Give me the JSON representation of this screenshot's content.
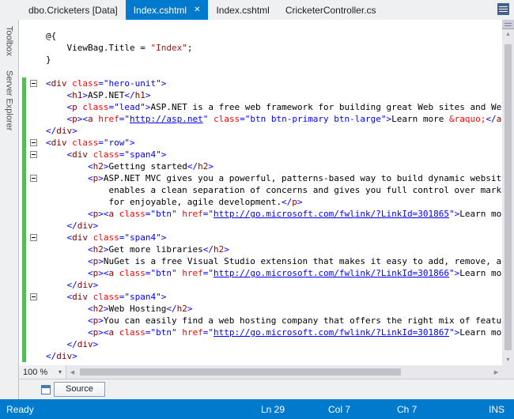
{
  "tabs": [
    {
      "label": "dbo.Cricketers [Data]",
      "active": false
    },
    {
      "label": "Index.cshtml",
      "active": true
    },
    {
      "label": "Index.cshtml",
      "active": false
    },
    {
      "label": "CricketerController.cs",
      "active": false
    }
  ],
  "tab_close_glyph": "✕",
  "side_tabs": [
    {
      "label": "Toolbox"
    },
    {
      "label": "Server Explorer"
    }
  ],
  "zoom": {
    "value": "100 %"
  },
  "view_tabs": {
    "source_label": "Source"
  },
  "status_bar": {
    "state": "Ready",
    "line": "Ln 29",
    "column": "Col 7",
    "character": "Ch 7",
    "mode": "INS"
  },
  "colors": {
    "accent": "#007ACC",
    "chrome_bg": "#EFF0F1",
    "editor_bg": "#FFFFFF",
    "change_bar": "#5BB75B",
    "tag_name": "#800000",
    "attr_name": "#FF0000",
    "attr_value": "#0000FF",
    "razor_string": "#A31515",
    "plain_text": "#000000"
  },
  "editor": {
    "lines": [
      {
        "g": false,
        "f": false,
        "s": [
          [
            "@{",
            "p"
          ]
        ]
      },
      {
        "g": false,
        "f": false,
        "s": [
          [
            "    ViewBag.Title = ",
            "p"
          ],
          [
            "\"Index\"",
            "s"
          ],
          [
            ";",
            "p"
          ]
        ]
      },
      {
        "g": false,
        "f": false,
        "s": [
          [
            "}",
            "p"
          ]
        ]
      },
      {
        "g": false,
        "f": false,
        "s": []
      },
      {
        "g": true,
        "f": true,
        "s": [
          [
            "<",
            "b"
          ],
          [
            "div",
            "t"
          ],
          [
            " ",
            "p"
          ],
          [
            "class",
            "a"
          ],
          [
            "=",
            "b"
          ],
          [
            "\"hero-unit\"",
            "b"
          ],
          [
            ">",
            "b"
          ]
        ]
      },
      {
        "g": true,
        "f": false,
        "s": [
          [
            "    ",
            "p"
          ],
          [
            "<",
            "b"
          ],
          [
            "h1",
            "t"
          ],
          [
            ">",
            "b"
          ],
          [
            "ASP.NET",
            "p"
          ],
          [
            "</",
            "b"
          ],
          [
            "h1",
            "t"
          ],
          [
            ">",
            "b"
          ]
        ]
      },
      {
        "g": true,
        "f": false,
        "s": [
          [
            "    ",
            "p"
          ],
          [
            "<",
            "b"
          ],
          [
            "p",
            "t"
          ],
          [
            " ",
            "p"
          ],
          [
            "class",
            "a"
          ],
          [
            "=",
            "b"
          ],
          [
            "\"lead\"",
            "b"
          ],
          [
            ">",
            "b"
          ],
          [
            "ASP.NET is a free web framework for building great Web sites and We",
            "p"
          ]
        ]
      },
      {
        "g": true,
        "f": false,
        "s": [
          [
            "    ",
            "p"
          ],
          [
            "<",
            "b"
          ],
          [
            "p",
            "t"
          ],
          [
            "><",
            "b"
          ],
          [
            "a",
            "t"
          ],
          [
            " ",
            "p"
          ],
          [
            "href",
            "a"
          ],
          [
            "=",
            "b"
          ],
          [
            "\"",
            "b"
          ],
          [
            "http://asp.net",
            "u"
          ],
          [
            "\"",
            "b"
          ],
          [
            " ",
            "p"
          ],
          [
            "class",
            "a"
          ],
          [
            "=",
            "b"
          ],
          [
            "\"btn btn-primary btn-large\"",
            "b"
          ],
          [
            ">",
            "b"
          ],
          [
            "Learn more ",
            "p"
          ],
          [
            "&raquo;",
            "a"
          ],
          [
            "</",
            "b"
          ],
          [
            "a",
            "t"
          ]
        ]
      },
      {
        "g": true,
        "f": false,
        "s": [
          [
            "</",
            "b"
          ],
          [
            "div",
            "t"
          ],
          [
            ">",
            "b"
          ]
        ]
      },
      {
        "g": true,
        "f": true,
        "s": [
          [
            "<",
            "b"
          ],
          [
            "div",
            "t"
          ],
          [
            " ",
            "p"
          ],
          [
            "class",
            "a"
          ],
          [
            "=",
            "b"
          ],
          [
            "\"row\"",
            "b"
          ],
          [
            ">",
            "b"
          ]
        ]
      },
      {
        "g": true,
        "f": true,
        "s": [
          [
            "    ",
            "p"
          ],
          [
            "<",
            "b"
          ],
          [
            "div",
            "t"
          ],
          [
            " ",
            "p"
          ],
          [
            "class",
            "a"
          ],
          [
            "=",
            "b"
          ],
          [
            "\"span4\"",
            "b"
          ],
          [
            ">",
            "b"
          ]
        ]
      },
      {
        "g": true,
        "f": false,
        "s": [
          [
            "        ",
            "p"
          ],
          [
            "<",
            "b"
          ],
          [
            "h2",
            "t"
          ],
          [
            ">",
            "b"
          ],
          [
            "Getting started",
            "p"
          ],
          [
            "</",
            "b"
          ],
          [
            "h2",
            "t"
          ],
          [
            ">",
            "b"
          ]
        ]
      },
      {
        "g": true,
        "f": true,
        "s": [
          [
            "        ",
            "p"
          ],
          [
            "<",
            "b"
          ],
          [
            "p",
            "t"
          ],
          [
            ">",
            "b"
          ],
          [
            "ASP.NET MVC gives you a powerful, patterns-based way to build dynamic websit",
            "p"
          ]
        ]
      },
      {
        "g": true,
        "f": false,
        "s": [
          [
            "            enables a clean separation of concerns and gives you full control over markup",
            "p"
          ]
        ]
      },
      {
        "g": true,
        "f": false,
        "s": [
          [
            "            for enjoyable, agile development.",
            "p"
          ],
          [
            "</",
            "b"
          ],
          [
            "p",
            "t"
          ],
          [
            ">",
            "b"
          ]
        ]
      },
      {
        "g": true,
        "f": false,
        "s": [
          [
            "        ",
            "p"
          ],
          [
            "<",
            "b"
          ],
          [
            "p",
            "t"
          ],
          [
            "><",
            "b"
          ],
          [
            "a",
            "t"
          ],
          [
            " ",
            "p"
          ],
          [
            "class",
            "a"
          ],
          [
            "=",
            "b"
          ],
          [
            "\"btn\"",
            "b"
          ],
          [
            " ",
            "p"
          ],
          [
            "href",
            "a"
          ],
          [
            "=",
            "b"
          ],
          [
            "\"",
            "b"
          ],
          [
            "http://go.microsoft.com/fwlink/?LinkId=301865",
            "u"
          ],
          [
            "\"",
            "b"
          ],
          [
            ">",
            "b"
          ],
          [
            "Learn mo",
            "p"
          ]
        ]
      },
      {
        "g": true,
        "f": false,
        "s": [
          [
            "    ",
            "p"
          ],
          [
            "</",
            "b"
          ],
          [
            "div",
            "t"
          ],
          [
            ">",
            "b"
          ]
        ]
      },
      {
        "g": true,
        "f": true,
        "s": [
          [
            "    ",
            "p"
          ],
          [
            "<",
            "b"
          ],
          [
            "div",
            "t"
          ],
          [
            " ",
            "p"
          ],
          [
            "class",
            "a"
          ],
          [
            "=",
            "b"
          ],
          [
            "\"span4\"",
            "b"
          ],
          [
            ">",
            "b"
          ]
        ]
      },
      {
        "g": true,
        "f": false,
        "s": [
          [
            "        ",
            "p"
          ],
          [
            "<",
            "b"
          ],
          [
            "h2",
            "t"
          ],
          [
            ">",
            "b"
          ],
          [
            "Get more libraries",
            "p"
          ],
          [
            "</",
            "b"
          ],
          [
            "h2",
            "t"
          ],
          [
            ">",
            "b"
          ]
        ]
      },
      {
        "g": true,
        "f": false,
        "s": [
          [
            "        ",
            "p"
          ],
          [
            "<",
            "b"
          ],
          [
            "p",
            "t"
          ],
          [
            ">",
            "b"
          ],
          [
            "NuGet is a free Visual Studio extension that makes it easy to add, remove, a",
            "p"
          ]
        ]
      },
      {
        "g": true,
        "f": false,
        "s": [
          [
            "        ",
            "p"
          ],
          [
            "<",
            "b"
          ],
          [
            "p",
            "t"
          ],
          [
            "><",
            "b"
          ],
          [
            "a",
            "t"
          ],
          [
            " ",
            "p"
          ],
          [
            "class",
            "a"
          ],
          [
            "=",
            "b"
          ],
          [
            "\"btn\"",
            "b"
          ],
          [
            " ",
            "p"
          ],
          [
            "href",
            "a"
          ],
          [
            "=",
            "b"
          ],
          [
            "\"",
            "b"
          ],
          [
            "http://go.microsoft.com/fwlink/?LinkId=301866",
            "u"
          ],
          [
            "\"",
            "b"
          ],
          [
            ">",
            "b"
          ],
          [
            "Learn mo",
            "p"
          ]
        ]
      },
      {
        "g": true,
        "f": false,
        "s": [
          [
            "    ",
            "p"
          ],
          [
            "</",
            "b"
          ],
          [
            "div",
            "t"
          ],
          [
            ">",
            "b"
          ]
        ]
      },
      {
        "g": true,
        "f": true,
        "s": [
          [
            "    ",
            "p"
          ],
          [
            "<",
            "b"
          ],
          [
            "div",
            "t"
          ],
          [
            " ",
            "p"
          ],
          [
            "class",
            "a"
          ],
          [
            "=",
            "b"
          ],
          [
            "\"span4\"",
            "b"
          ],
          [
            ">",
            "b"
          ]
        ]
      },
      {
        "g": true,
        "f": false,
        "s": [
          [
            "        ",
            "p"
          ],
          [
            "<",
            "b"
          ],
          [
            "h2",
            "t"
          ],
          [
            ">",
            "b"
          ],
          [
            "Web Hosting",
            "p"
          ],
          [
            "</",
            "b"
          ],
          [
            "h2",
            "t"
          ],
          [
            ">",
            "b"
          ]
        ]
      },
      {
        "g": true,
        "f": false,
        "s": [
          [
            "        ",
            "p"
          ],
          [
            "<",
            "b"
          ],
          [
            "p",
            "t"
          ],
          [
            ">",
            "b"
          ],
          [
            "You can easily find a web hosting company that offers the right mix of featu",
            "p"
          ]
        ]
      },
      {
        "g": true,
        "f": false,
        "s": [
          [
            "        ",
            "p"
          ],
          [
            "<",
            "b"
          ],
          [
            "p",
            "t"
          ],
          [
            "><",
            "b"
          ],
          [
            "a",
            "t"
          ],
          [
            " ",
            "p"
          ],
          [
            "class",
            "a"
          ],
          [
            "=",
            "b"
          ],
          [
            "\"btn\"",
            "b"
          ],
          [
            " ",
            "p"
          ],
          [
            "href",
            "a"
          ],
          [
            "=",
            "b"
          ],
          [
            "\"",
            "b"
          ],
          [
            "http://go.microsoft.com/fwlink/?LinkId=301867",
            "u"
          ],
          [
            "\"",
            "b"
          ],
          [
            ">",
            "b"
          ],
          [
            "Learn mo",
            "p"
          ]
        ]
      },
      {
        "g": true,
        "f": false,
        "s": [
          [
            "    ",
            "p"
          ],
          [
            "</",
            "b"
          ],
          [
            "div",
            "t"
          ],
          [
            ">",
            "b"
          ]
        ]
      },
      {
        "g": true,
        "f": false,
        "s": [
          [
            "</",
            "b"
          ],
          [
            "div",
            "t"
          ],
          [
            ">",
            "b"
          ]
        ]
      }
    ]
  }
}
